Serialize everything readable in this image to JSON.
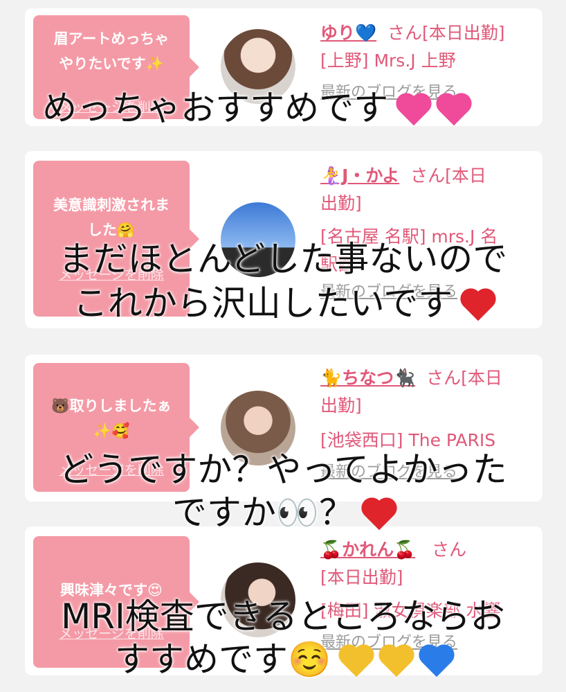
{
  "colors": {
    "accent": "#e05878",
    "bubble": "#f49aa6",
    "heart_red": "#e0242c",
    "heart_pink": "#f04a9a",
    "heart_blue": "#2a7de8",
    "heart_yellow": "#f3c02d"
  },
  "cards": [
    {
      "message_line1": "眉アートめっちゃ",
      "message_line2": "やりたいです✨",
      "delete_label": "メッセージを削除",
      "name": "ゆり💙",
      "san": "さん[本日出勤]",
      "shop": "[上野] Mrs.J 上野",
      "blog": "最新のブログを見る"
    },
    {
      "message_line1": "美意識刺激されま",
      "message_line2": "した🤗",
      "delete_label": "メッセージを削除",
      "name": "🧜‍♀️J・かよ",
      "san": "さん[本日",
      "status2": "出勤]",
      "shop": "[名古屋 名駅] mrs.J 名",
      "shop2": "駅西",
      "blog": "最新のブログを見る"
    },
    {
      "message_line1": "🐻取りしましたぁ",
      "message_line2": "✨🥰",
      "delete_label": "メッセージを削除",
      "name": "🐈ちなつ🐈‍⬛",
      "san": "さん[本日",
      "status2": "出勤]",
      "shop": "[池袋西口] The PARIS",
      "blog": "最新のブログを見る"
    },
    {
      "message_line1": "興味津々です😍",
      "message_line2": "",
      "delete_label": "メッセージを削除",
      "name": "🍒かれん🍒",
      "san": "さん",
      "status2": "[本日出勤]",
      "shop": "[梅田] 淑女倶楽部 水響",
      "blog": "最新のブログを見る"
    }
  ],
  "captions": {
    "c1": "めっちゃおすすめです",
    "c2a": "まだほとんどした事ないので",
    "c2b": "これから沢山したいです",
    "c3a": "どうですか？やってよかった",
    "c3b": "ですか👀？",
    "c4a": "MRI検査できるところならお",
    "c4b": "すすめです☺️"
  }
}
